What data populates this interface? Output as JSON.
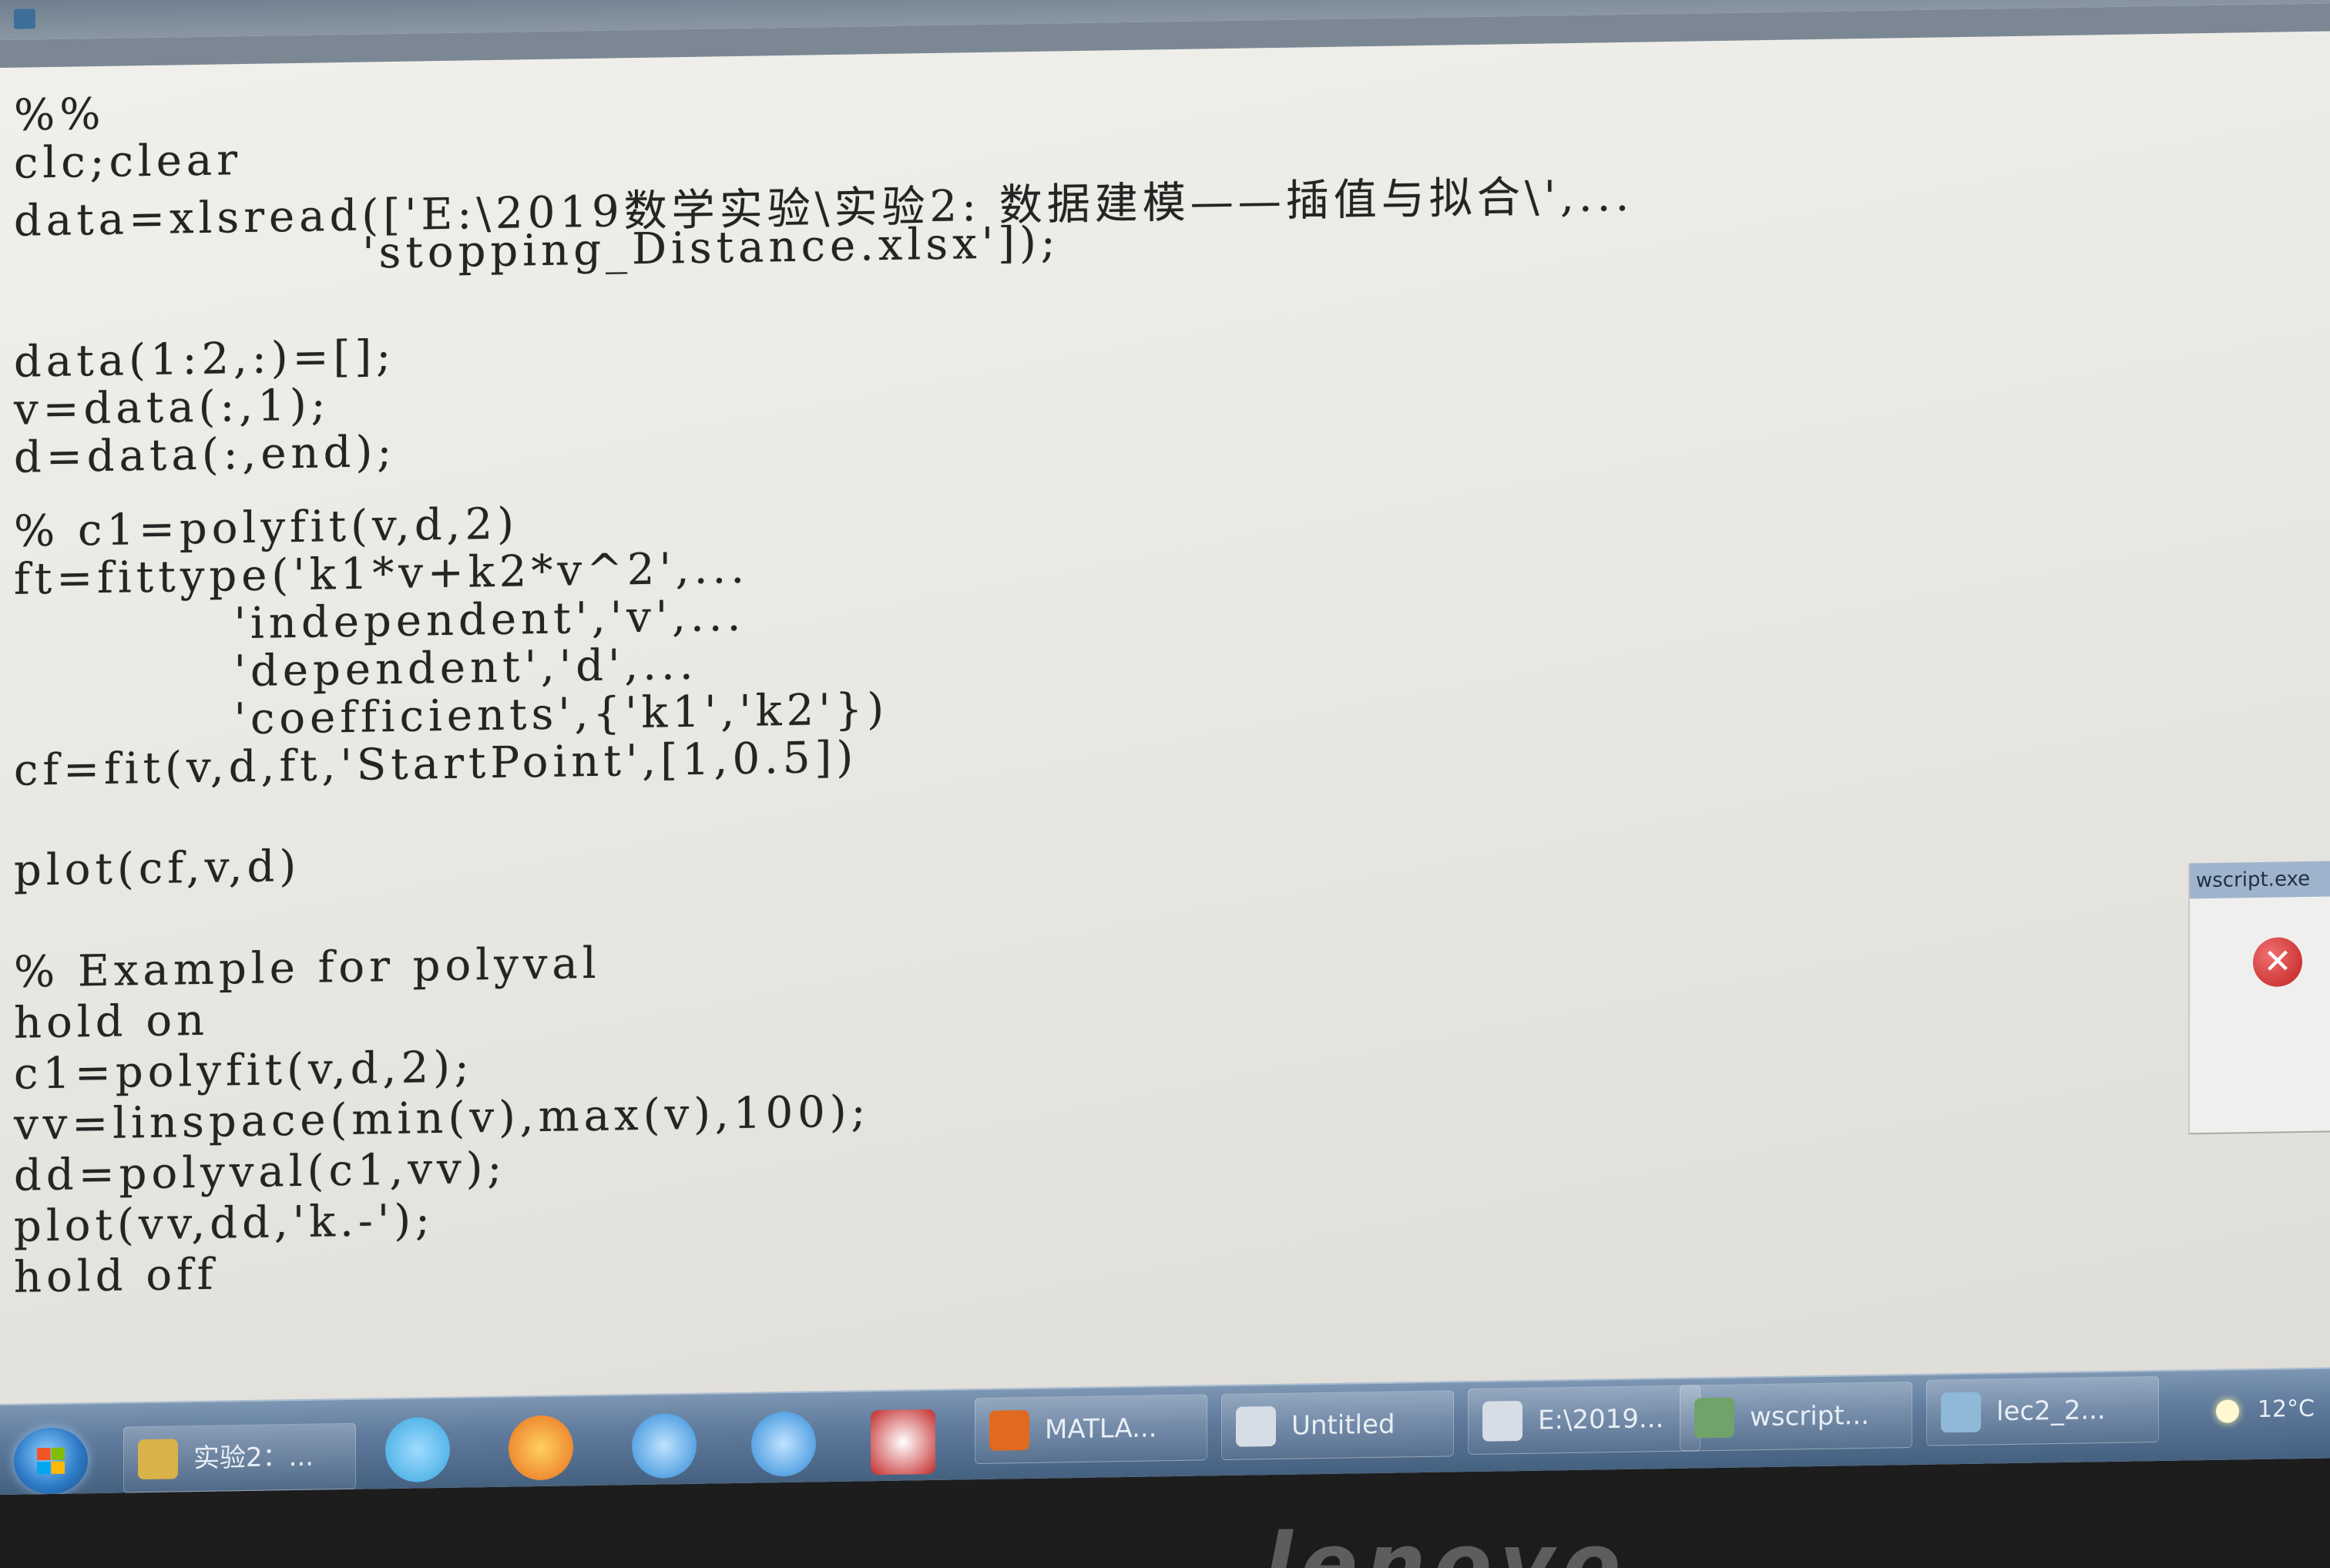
{
  "window": {
    "title": "",
    "menu": []
  },
  "editor": {
    "lines": [
      "%%",
      "clc;clear",
      "data=xlsread(['E:\\2019数学实验\\实验2: 数据建模——插值与拟合\\',...",
      "                   'stopping_Distance.xlsx']);",
      "",
      "",
      "data(1:2,:)=[];",
      "v=data(:,1);",
      "d=data(:,end);",
      "",
      "% c1=polyfit(v,d,2)",
      "ft=fittype('k1*v+k2*v^2',...",
      "            'independent','v',...",
      "            'dependent','d',...",
      "            'coefficients',{'k1','k2'})",
      "cf=fit(v,d,ft,'StartPoint',[1,0.5])",
      "",
      "plot(cf,v,d)",
      "",
      "% Example for polyval",
      "hold on",
      "c1=polyfit(v,d,2);",
      "vv=linspace(min(v),max(v),100);",
      "dd=polyval(c1,vv);",
      "plot(vv,dd,'k.-');",
      "hold off"
    ]
  },
  "popup": {
    "title": "wscript.exe",
    "icon": "error-icon"
  },
  "taskbar": {
    "start_icon": "windows-logo-icon",
    "items": [
      {
        "label": "实验2：...",
        "icon": "folder-icon",
        "color": "#d9b24a"
      },
      {
        "label": "MATLA...",
        "icon": "matlab-icon",
        "color": "#e06a1f"
      },
      {
        "label": "Untitled",
        "icon": "notepad-icon",
        "color": "#d7dde6"
      },
      {
        "label": "E:\\2019...",
        "icon": "notepad-icon",
        "color": "#d7dde6"
      },
      {
        "label": "wscript...",
        "icon": "window-icon",
        "color": "#6fa36a"
      },
      {
        "label": "lec2_2...",
        "icon": "document-icon",
        "color": "#8fb8d9"
      }
    ],
    "pinned": [
      {
        "icon": "qq-icon",
        "color": "#3aa6e0"
      },
      {
        "icon": "firefox-icon",
        "color": "#e8701f"
      },
      {
        "icon": "ie-icon",
        "color": "#2f8ad8"
      },
      {
        "icon": "ie-icon",
        "color": "#2f8ad8"
      },
      {
        "icon": "app-icon",
        "color": "#c42a2a"
      }
    ],
    "weather": "12°C"
  },
  "bezel": {
    "logo": "lenovo"
  }
}
